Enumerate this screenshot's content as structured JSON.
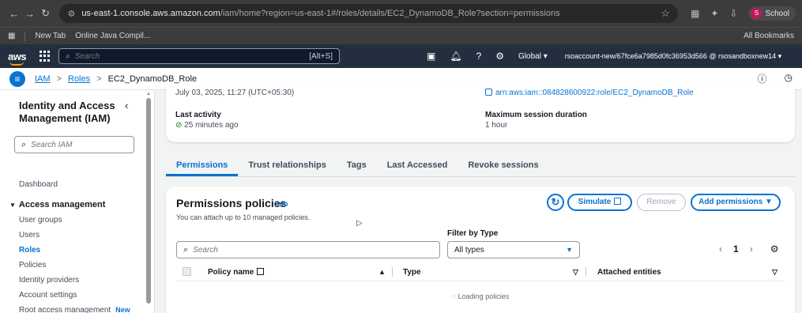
{
  "browser": {
    "url_host": "us-east-1.console.aws.amazon.com",
    "url_path": "/iam/home?region=us-east-1#/roles/details/EC2_DynamoDB_Role?section=permissions",
    "profile_label": "School",
    "profile_initial": "S"
  },
  "bookmarks": {
    "items": [
      "New Tab",
      "Online Java Compil..."
    ],
    "all_label": "All Bookmarks"
  },
  "aws_header": {
    "logo": "aws",
    "search_placeholder": "Search",
    "search_shortcut": "[Alt+S]",
    "region": "Global ▾",
    "account": "rsoaccount-new/67fce6a7985d0fc36953d566 @ rsosandboxnew14 ▾"
  },
  "breadcrumb": {
    "items": [
      "IAM",
      "Roles",
      "EC2_DynamoDB_Role"
    ]
  },
  "sidebar": {
    "title": "Identity and Access Management (IAM)",
    "search_placeholder": "Search IAM",
    "dashboard": "Dashboard",
    "section": "Access management",
    "items": [
      "User groups",
      "Users",
      "Roles",
      "Policies",
      "Identity providers",
      "Account settings",
      "Root access management"
    ],
    "active_item": "Roles",
    "new_badge": "New"
  },
  "summary": {
    "creation_date": "July 03, 2025, 11:27 (UTC+05:30)",
    "arn": "arn:aws:iam::084828600922:role/EC2_DynamoDB_Role",
    "last_activity_label": "Last activity",
    "last_activity_value": "25 minutes ago",
    "max_session_label": "Maximum session duration",
    "max_session_value": "1 hour"
  },
  "tabs": [
    "Permissions",
    "Trust relationships",
    "Tags",
    "Last Accessed",
    "Revoke sessions"
  ],
  "policies": {
    "title": "Permissions policies",
    "info": "Info",
    "description": "You can attach up to 10 managed policies.",
    "simulate_label": "Simulate",
    "remove_label": "Remove",
    "add_label": "Add permissions ▼",
    "filter_label": "Filter by Type",
    "search_placeholder": "Search",
    "filter_value": "All types",
    "page": "1",
    "columns": [
      "Policy name",
      "Type",
      "Attached entities"
    ],
    "loading": "Loading policies"
  },
  "colors": {
    "aws_header": "#232f3e",
    "accent_blue": "#0972d3",
    "aws_orange": "#ff9900"
  }
}
